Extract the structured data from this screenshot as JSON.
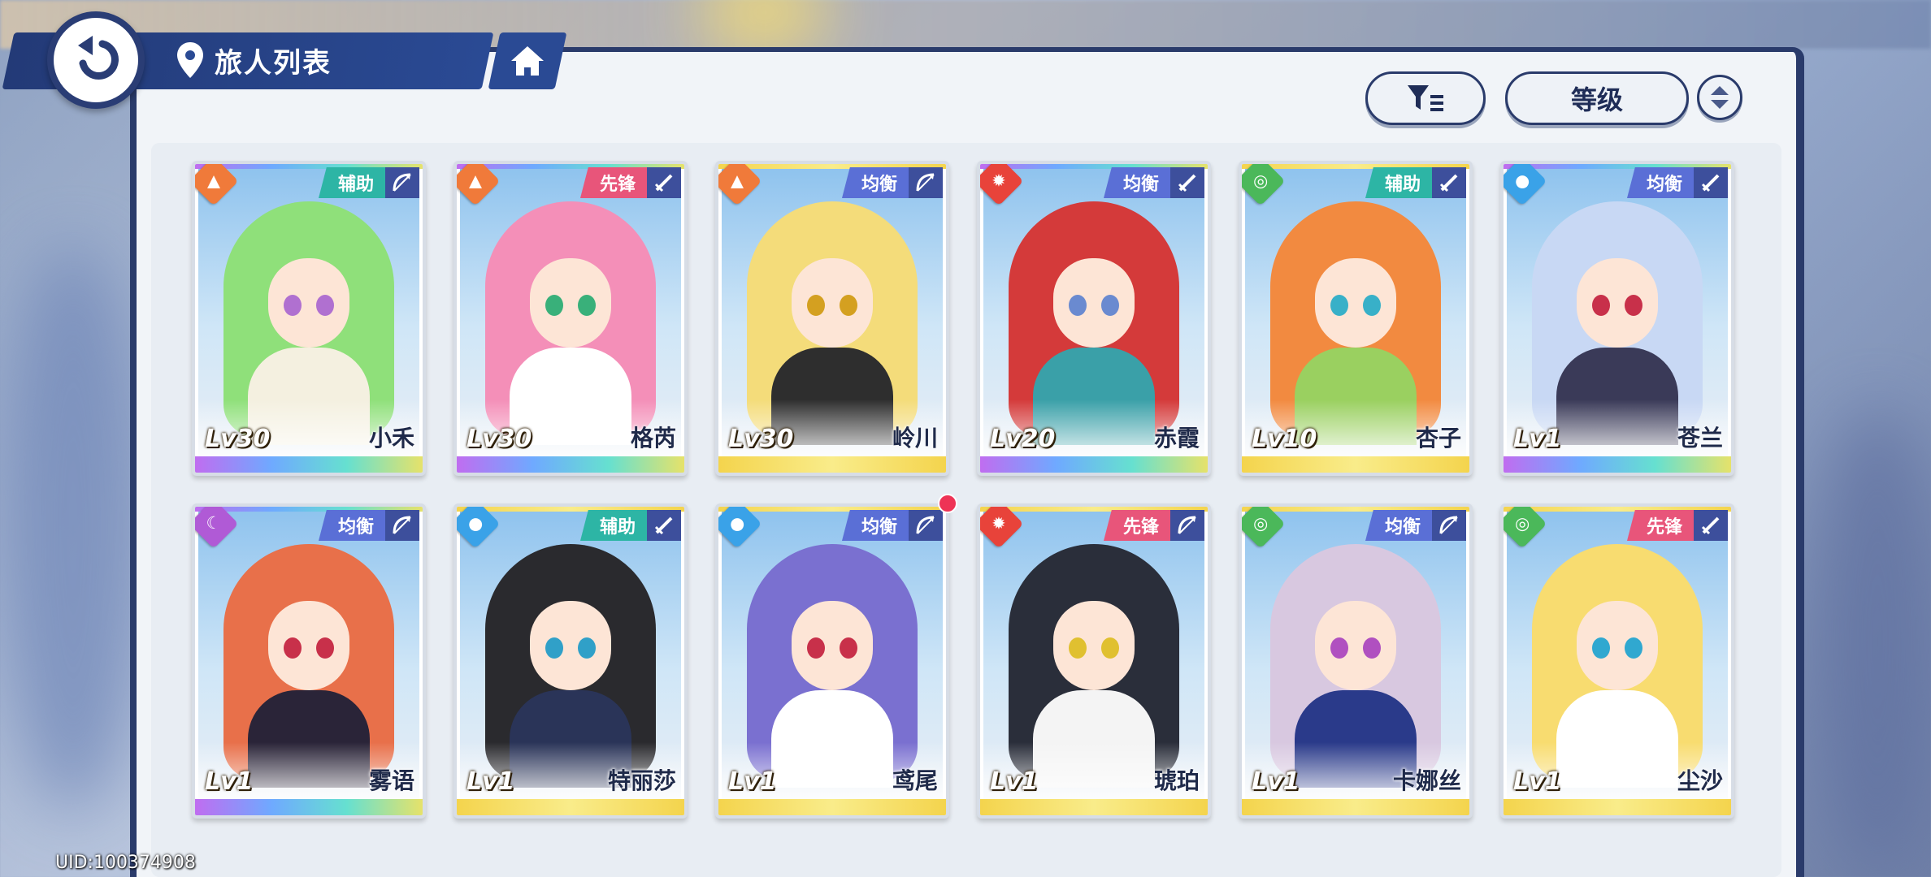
{
  "header": {
    "title": "旅人列表",
    "back_icon": "back-arrow-icon",
    "location_icon": "map-pin-icon",
    "home_icon": "home-icon"
  },
  "toolbar": {
    "filter_icon": "filter-icon",
    "sort_label": "等级",
    "order_icon": "sort-order-icon"
  },
  "colors": {
    "navy": "#2a3b6b",
    "role_support": "#2db5a5",
    "role_vanguard": "#e8557a",
    "role_balanced": "#5a6fd6",
    "elem_earth": "#f07a3a",
    "elem_fire": "#e8433a",
    "elem_wind": "#4bb85a",
    "elem_water": "#3aa2e8",
    "elem_moon": "#b05ad6"
  },
  "characters": [
    {
      "name": "小禾",
      "level": "Lv30",
      "role": "辅助",
      "role_type": "support",
      "element": "earth",
      "weapon": "bow-icon",
      "hair": "#8fe07a",
      "eye": "#b070d0",
      "outfit": "#f4f0e0",
      "rim": "rainbow"
    },
    {
      "name": "格芮",
      "level": "Lv30",
      "role": "先锋",
      "role_type": "vanguard",
      "element": "earth",
      "weapon": "sword-icon",
      "hair": "#f48fb8",
      "eye": "#39b07a",
      "outfit": "#ffffff",
      "rim": "rainbow"
    },
    {
      "name": "岭川",
      "level": "Lv30",
      "role": "均衡",
      "role_type": "balanced",
      "element": "earth",
      "weapon": "bow-icon",
      "hair": "#f4dc7a",
      "eye": "#d4a020",
      "outfit": "#2e2e2e",
      "rim": "gold"
    },
    {
      "name": "赤霞",
      "level": "Lv20",
      "role": "均衡",
      "role_type": "balanced",
      "element": "fire",
      "weapon": "sword-icon",
      "hair": "#d43a3a",
      "eye": "#6a8ad0",
      "outfit": "#3aa0a8",
      "rim": "rainbow"
    },
    {
      "name": "杏子",
      "level": "Lv10",
      "role": "辅助",
      "role_type": "support",
      "element": "wind",
      "weapon": "sword-icon",
      "hair": "#f28a40",
      "eye": "#38b0c8",
      "outfit": "#9ad060",
      "rim": "gold"
    },
    {
      "name": "苍兰",
      "level": "Lv1",
      "role": "均衡",
      "role_type": "balanced",
      "element": "water",
      "weapon": "sword-icon",
      "hair": "#c8d8f4",
      "eye": "#c8304a",
      "outfit": "#3a3a58",
      "rim": "rainbow"
    },
    {
      "name": "雾语",
      "level": "Lv1",
      "role": "均衡",
      "role_type": "balanced",
      "element": "moon",
      "weapon": "bow-icon",
      "hair": "#e8704a",
      "eye": "#c8304a",
      "outfit": "#2a2438",
      "rim": "rainbow"
    },
    {
      "name": "特丽莎",
      "level": "Lv1",
      "role": "辅助",
      "role_type": "support",
      "element": "water",
      "weapon": "sword-icon",
      "hair": "#2a2a2e",
      "eye": "#30a0c8",
      "outfit": "#2a3458",
      "rim": "gold"
    },
    {
      "name": "鸢尾",
      "level": "Lv1",
      "role": "均衡",
      "role_type": "balanced",
      "element": "water",
      "weapon": "bow-icon",
      "hair": "#7a70d0",
      "eye": "#c8304a",
      "outfit": "#ffffff",
      "rim": "gold",
      "notify": true
    },
    {
      "name": "琥珀",
      "level": "Lv1",
      "role": "先锋",
      "role_type": "vanguard",
      "element": "fire",
      "weapon": "bow-icon",
      "hair": "#2a2e3a",
      "eye": "#e0c030",
      "outfit": "#f4f4f4",
      "rim": "gold"
    },
    {
      "name": "卡娜丝",
      "level": "Lv1",
      "role": "均衡",
      "role_type": "balanced",
      "element": "wind",
      "weapon": "bow-icon",
      "hair": "#d8c8e0",
      "eye": "#b050c0",
      "outfit": "#2a3a8a",
      "rim": "gold"
    },
    {
      "name": "尘沙",
      "level": "Lv1",
      "role": "先锋",
      "role_type": "vanguard",
      "element": "wind",
      "weapon": "sword-icon",
      "hair": "#f8dc70",
      "eye": "#30a8d0",
      "outfit": "#ffffff",
      "rim": "gold"
    }
  ],
  "uid": "UID:100374908"
}
